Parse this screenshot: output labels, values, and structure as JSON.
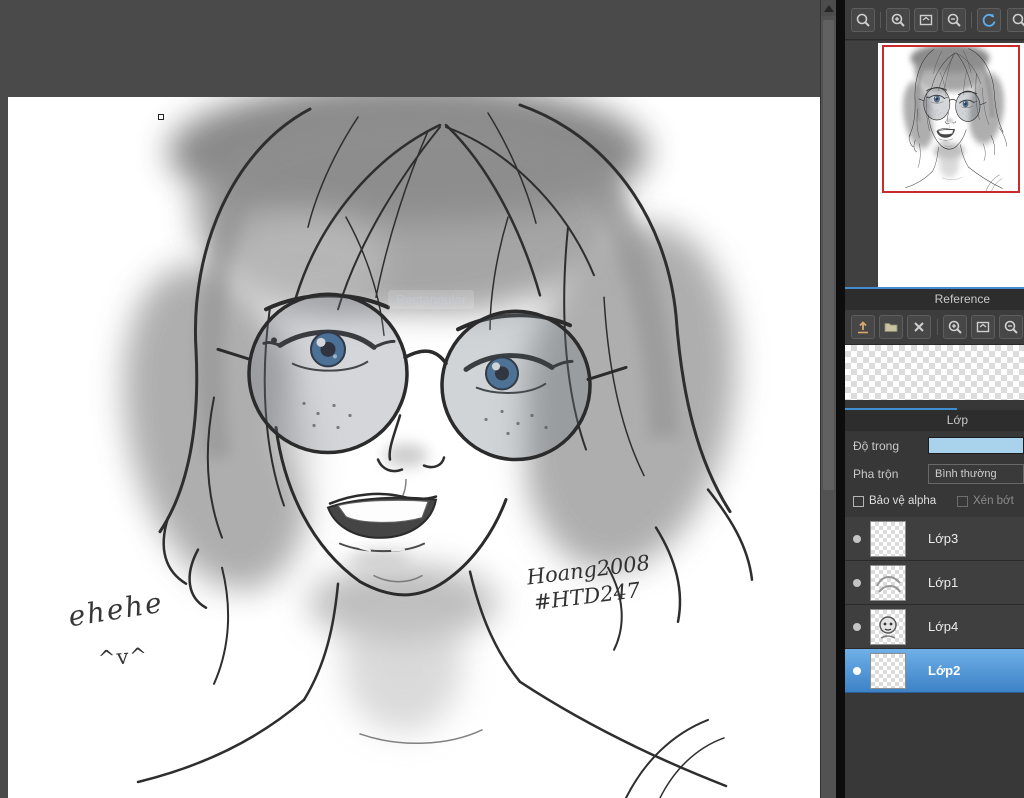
{
  "canvas": {
    "tool_hint": "Rectangular",
    "annotations": {
      "laugh": "ehehe",
      "cat_face": "^v^",
      "signature_line1": "Hoang2008",
      "signature_line2": "#HTD247"
    }
  },
  "top_toolbar": {
    "icons": [
      "zoom-tool",
      "zoom-in",
      "fit-screen",
      "zoom-out",
      "reset-view",
      "more"
    ]
  },
  "reference": {
    "title": "Reference",
    "icons": [
      "upload",
      "open-folder",
      "clear",
      "zoom-in",
      "fit-screen",
      "zoom-out"
    ]
  },
  "layer_panel": {
    "title": "Lớp",
    "opacity_label": "Độ trong",
    "blend_label": "Pha trộn",
    "blend_value": "Bình thường",
    "protect_alpha_label": "Bảo vệ alpha",
    "clipping_label": "Xén bớt",
    "layers": [
      {
        "name": "Lớp3",
        "selected": false
      },
      {
        "name": "Lớp1",
        "selected": false
      },
      {
        "name": "Lớp4",
        "selected": false
      },
      {
        "name": "Lớp2",
        "selected": true
      }
    ]
  },
  "colors": {
    "accent": "#3f8fd0",
    "selected_layer_top": "#6fb0e8",
    "selected_layer_bottom": "#3d82c6",
    "navigator_border": "#c92a2a",
    "opacity_fill": "#a9d2ec"
  }
}
